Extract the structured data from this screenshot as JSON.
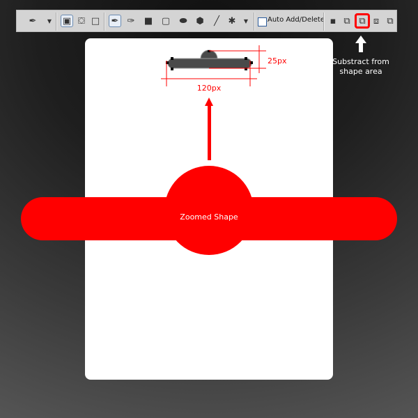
{
  "toolbar": {
    "tools": [
      "pen-tool",
      "shape-layers",
      "paths",
      "fill-pixels",
      "pen",
      "freeform-pen",
      "rectangle",
      "rounded-rectangle",
      "ellipse",
      "polygon",
      "line",
      "custom-shape"
    ],
    "auto_add_delete_label": "Auto Add/Delete",
    "auto_add_delete_checked": false,
    "path_modes": [
      "create-new-shape-layer",
      "add-to-shape-area",
      "subtract-from-shape-area",
      "intersect-shape-areas",
      "exclude-overlapping-shape-areas"
    ],
    "highlighted_mode": "subtract-from-shape-area"
  },
  "annotation": {
    "note_line1": "Substract from",
    "note_line2": "shape area",
    "height_label": "25px",
    "width_label": "120px",
    "zoomed_label": "Zoomed Shape"
  },
  "colors": {
    "accent": "#ff0000",
    "shape": "#4a4a4a",
    "paper": "#ffffff"
  }
}
